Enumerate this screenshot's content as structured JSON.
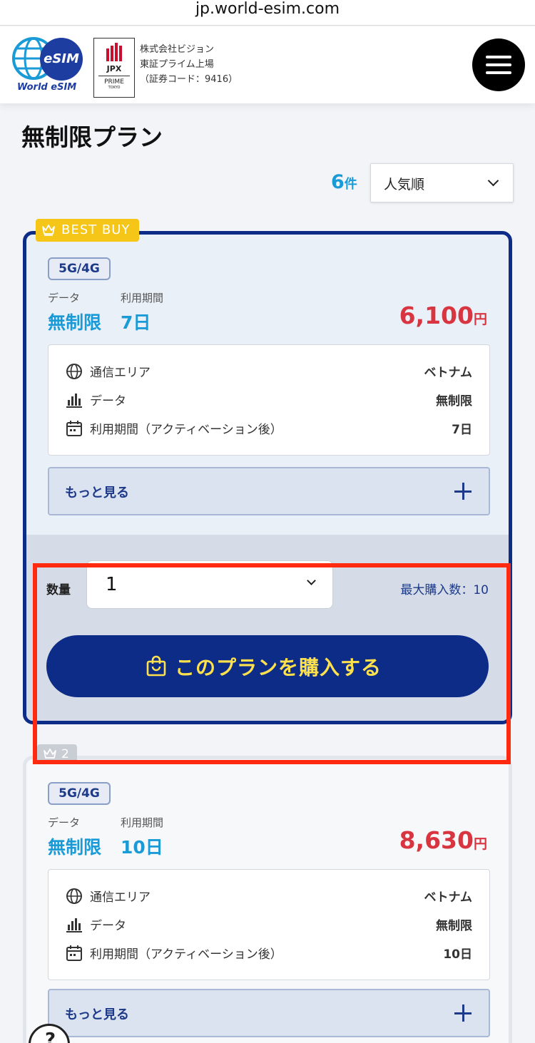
{
  "browser": {
    "url": "jp.world-esim.com"
  },
  "header": {
    "logo_text": "World eSIM",
    "logo_badge": "eSIM",
    "jpx": {
      "title": "JPX",
      "prime": "PRIME",
      "tokyo": "TOKYO"
    },
    "company_lines": [
      "株式会社ビジョン",
      "東証プライム上場",
      "（証券コード：9416）"
    ]
  },
  "page": {
    "title": "無制限プラン",
    "result_count": "6",
    "result_unit": "件",
    "sort_selected": "人気順"
  },
  "plans": [
    {
      "badge": "BEST BUY",
      "network": "5G/4G",
      "data_label": "データ",
      "period_label": "利用期間",
      "data_value": "無制限",
      "period_value": "7日",
      "price": "6,100",
      "currency": "円",
      "rows": [
        {
          "icon": "globe-icon",
          "label": "通信エリア",
          "value": "ベトナム"
        },
        {
          "icon": "bar-chart-icon",
          "label": "データ",
          "value": "無制限"
        },
        {
          "icon": "calendar-icon",
          "label": "利用期間（アクティベーション後）",
          "value": "7日"
        }
      ],
      "more_label": "もっと見る",
      "qty_label": "数量",
      "qty_value": "1",
      "max_label": "最大購入数：10",
      "buy_label": "このプランを購入する"
    },
    {
      "badge": "2",
      "network": "5G/4G",
      "data_label": "データ",
      "period_label": "利用期間",
      "data_value": "無制限",
      "period_value": "10日",
      "price": "8,630",
      "currency": "円",
      "rows": [
        {
          "icon": "globe-icon",
          "label": "通信エリア",
          "value": "ベトナム"
        },
        {
          "icon": "bar-chart-icon",
          "label": "データ",
          "value": "無制限"
        },
        {
          "icon": "calendar-icon",
          "label": "利用期間（アクティベーション後）",
          "value": "10日"
        }
      ],
      "more_label": "もっと見る"
    }
  ],
  "help_fab": "?",
  "colors": {
    "navy": "#0d2c87",
    "accent_blue": "#1a9ad6",
    "price_red": "#d93540",
    "best_buy_gold": "#f5c518",
    "highlight_red": "#ff2a0f"
  }
}
